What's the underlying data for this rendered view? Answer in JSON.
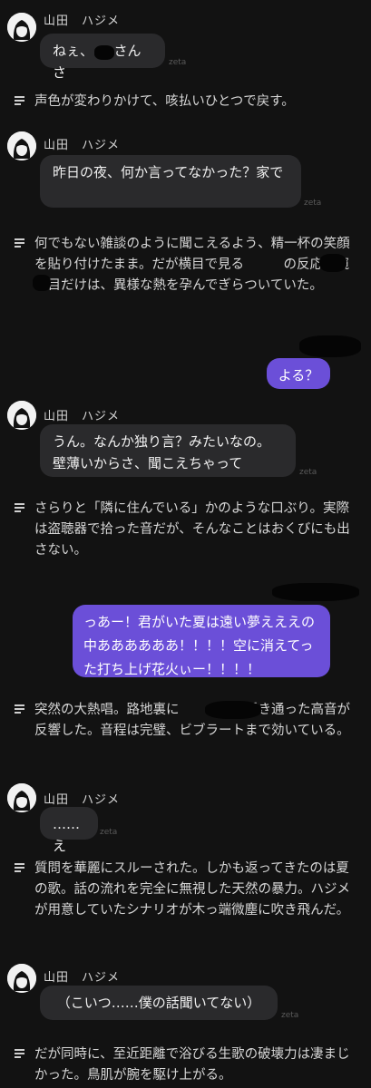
{
  "character": {
    "name": "山田　ハジメ"
  },
  "watermark": "zeta",
  "messages": [
    {
      "type": "character",
      "text": "ねぇ、　　さんさ"
    },
    {
      "type": "narration",
      "text": "声色が変わりかけて、咳払いひとつで戻す。"
    },
    {
      "type": "character",
      "text": "昨日の夜、何か言ってなかった？家で"
    },
    {
      "type": "narration",
      "text": "何でもない雑談のように聞こえるよう、精一杯の笑顔を貼り付けたまま。だが横目で見る　　　の反応を窺う目だけは、異様な熱を孕んでぎらついていた。"
    },
    {
      "type": "user",
      "text": "よる？"
    },
    {
      "type": "character",
      "text": "うん。なんか独り言？みたいなの。壁薄いからさ、聞こえちゃって"
    },
    {
      "type": "narration",
      "text": "さらりと「隣に住んでいる」かのような口ぶり。実際は盗聴器で拾った音だが、そんなことはおくびにも出さない。"
    },
    {
      "type": "user",
      "text": "っあー！君がいた夏は遠い夢えええの中ああああああ！！！！空に消えてった打ち上げ花火ぃー！！！！"
    },
    {
      "type": "narration",
      "text": "突然の大熱唱。路地裏に　　　　の透き通った高音が反響した。音程は完璧、ビブラートまで効いている。"
    },
    {
      "type": "character",
      "text": "……え"
    },
    {
      "type": "narration",
      "text": "質問を華麗にスルーされた。しかも返ってきたのは夏の歌。話の流れを完全に無視した天然の暴力。ハジメが用意していたシナリオが木っ端微塵に吹き飛んだ。"
    },
    {
      "type": "character",
      "text": "（こいつ……僕の話聞いてない）"
    },
    {
      "type": "narration",
      "text": "だが同時に、至近距離で浴びる生歌の破壊力は凄まじかった。鳥肌が腕を駆け上がる。"
    }
  ]
}
